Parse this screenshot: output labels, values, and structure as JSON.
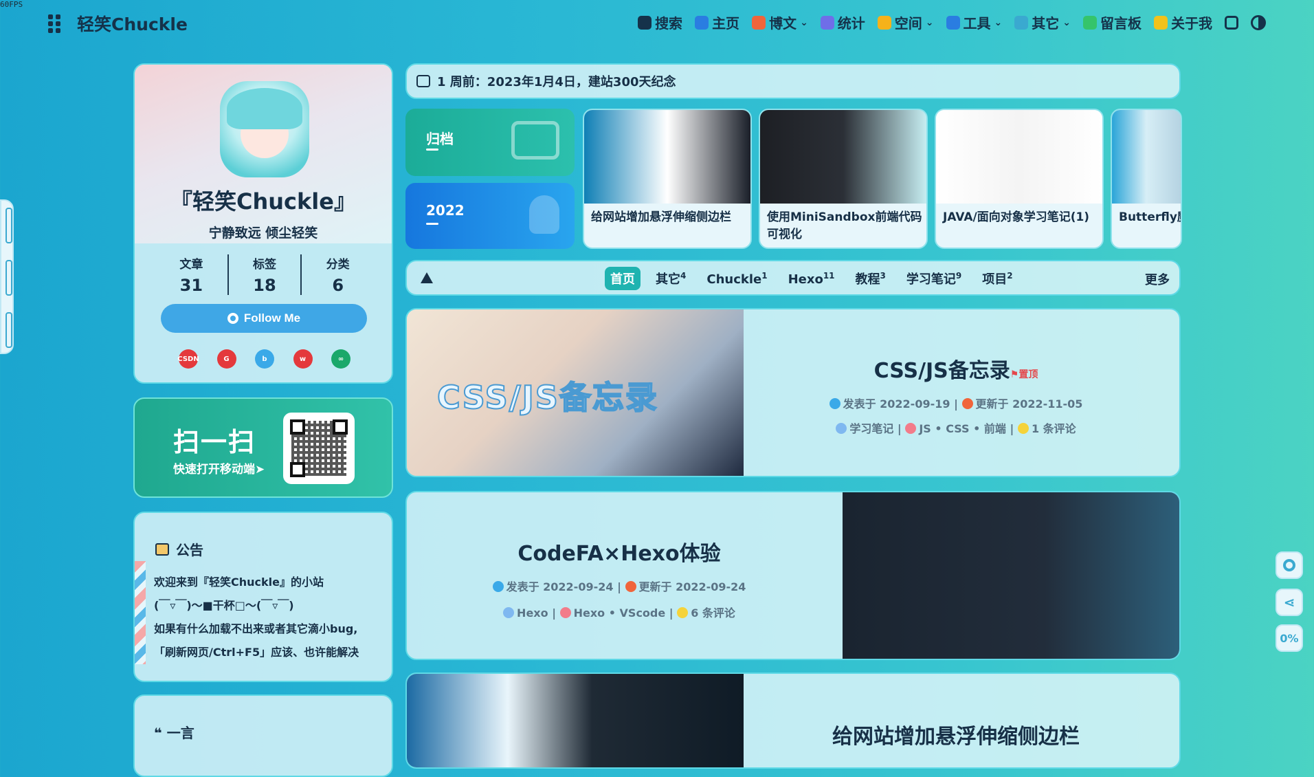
{
  "fps": "60FPS",
  "brand": "轻笑Chuckle",
  "nav": [
    {
      "label": "搜索",
      "icon": "search-icon",
      "color": "#15324a",
      "dropdown": false
    },
    {
      "label": "主页",
      "icon": "home-icon",
      "color": "#2a7de1",
      "dropdown": false
    },
    {
      "label": "博文",
      "icon": "post-icon",
      "color": "#f0653b",
      "dropdown": true
    },
    {
      "label": "统计",
      "icon": "chart-icon",
      "color": "#6f6ee8",
      "dropdown": false
    },
    {
      "label": "空间",
      "icon": "space-icon",
      "color": "#f6b21a",
      "dropdown": true
    },
    {
      "label": "工具",
      "icon": "gear-icon",
      "color": "#2a7de1",
      "dropdown": true
    },
    {
      "label": "其它",
      "icon": "send-icon",
      "color": "#3aa9d0",
      "dropdown": true
    },
    {
      "label": "留言板",
      "icon": "message-icon",
      "color": "#35c46b",
      "dropdown": false
    },
    {
      "label": "关于我",
      "icon": "heart-icon",
      "color": "#f2c21b",
      "dropdown": false
    }
  ],
  "profile": {
    "name": "『轻笑Chuckle』",
    "motto": "宁静致远 倾尘轻笑",
    "stats": [
      {
        "label": "文章",
        "value": "31"
      },
      {
        "label": "标签",
        "value": "18"
      },
      {
        "label": "分类",
        "value": "6"
      }
    ],
    "follow": "Follow Me",
    "socials": [
      {
        "name": "csdn",
        "label": "CSDN",
        "color": "#e4393c"
      },
      {
        "name": "gitee",
        "label": "G",
        "color": "#e4393c"
      },
      {
        "name": "bilibili",
        "label": "b",
        "color": "#3aa9e8"
      },
      {
        "name": "weibo",
        "label": "w",
        "color": "#e4393c"
      },
      {
        "name": "netease",
        "label": "∞",
        "color": "#1aa86a"
      }
    ]
  },
  "qr": {
    "title": "扫一扫",
    "subtitle": "快速打开移动端➤"
  },
  "notice": {
    "title": "公告",
    "lines": [
      "欢迎来到『轻笑Chuckle』的小站",
      "(￣▿￣)～■干杯□～(￣▿￣)",
      "如果有什么加载不出来或者其它滴小bug,",
      "「刷新网页/Ctrl+F5」应该、也许能解决"
    ]
  },
  "yiyan": {
    "title": "一言"
  },
  "announce_bar": "1 周前：2023年1月4日，建站300天纪念",
  "tiles": {
    "archive": "归档",
    "year": "2022"
  },
  "recent": [
    {
      "title": "给网站增加悬浮伸缩侧边栏",
      "colors": [
        "#0f7fb5",
        "#ffffff",
        "#1a1f29"
      ]
    },
    {
      "title": "使用MiniSandbox前端代码可视化",
      "colors": [
        "#1d1f24",
        "#2b2f36",
        "#c6edf1"
      ]
    },
    {
      "title": "JAVA/面向对象学习笔记(1)",
      "colors": [
        "#ffffff",
        "#f4f4f4",
        "#ffffff"
      ]
    },
    {
      "title": "Butterfly魔",
      "colors": [
        "#2aa5d8",
        "#d7eef6",
        "#b5d3e2"
      ]
    }
  ],
  "categories": [
    {
      "label": "首页",
      "count": "",
      "active": true
    },
    {
      "label": "其它",
      "count": "4",
      "active": false
    },
    {
      "label": "Chuckle",
      "count": "1",
      "active": false
    },
    {
      "label": "Hexo",
      "count": "11",
      "active": false
    },
    {
      "label": "教程",
      "count": "3",
      "active": false
    },
    {
      "label": "学习笔记",
      "count": "9",
      "active": false
    },
    {
      "label": "项目",
      "count": "2",
      "active": false
    }
  ],
  "more": "更多",
  "posts": [
    {
      "title": "CSS/JS备忘录",
      "sticky": "置顶",
      "cover_text": "CSS/JS备忘录",
      "published": "发表于 2022-09-19",
      "updated": "更新于 2022-11-05",
      "category": "学习笔记",
      "tags": "JS • CSS • 前端",
      "comments": "1 条评论"
    },
    {
      "title": "CodeFA×Hexo体验",
      "sticky": "",
      "cover_text": "",
      "published": "发表于 2022-09-24",
      "updated": "更新于 2022-09-24",
      "category": "Hexo",
      "tags": "Hexo • VScode",
      "comments": "6 条评论"
    },
    {
      "title": "给网站增加悬浮伸缩侧边栏",
      "sticky": "",
      "cover_text": "",
      "published": "",
      "updated": "",
      "category": "",
      "tags": "",
      "comments": ""
    }
  ],
  "right_side": {
    "progress": "0%"
  }
}
